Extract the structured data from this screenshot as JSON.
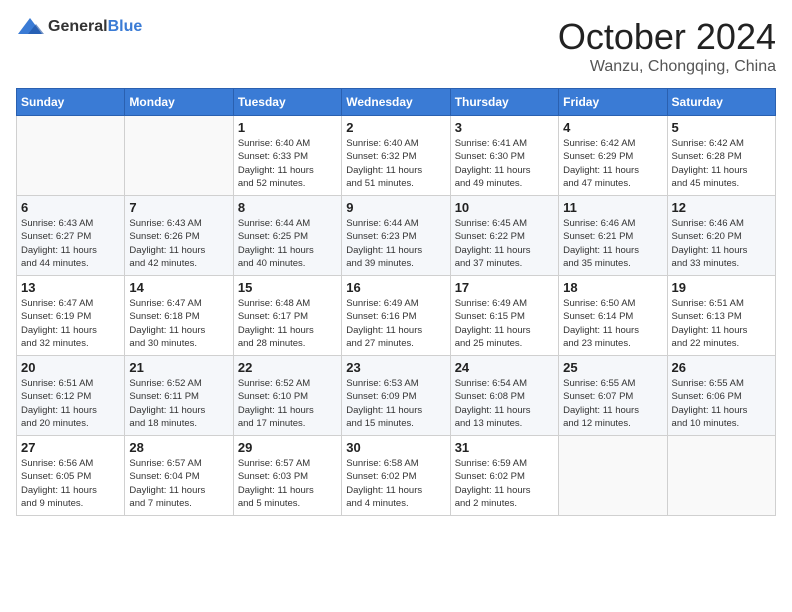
{
  "logo": {
    "general": "General",
    "blue": "Blue"
  },
  "title": {
    "month": "October 2024",
    "location": "Wanzu, Chongqing, China"
  },
  "headers": [
    "Sunday",
    "Monday",
    "Tuesday",
    "Wednesday",
    "Thursday",
    "Friday",
    "Saturday"
  ],
  "weeks": [
    [
      {
        "day": "",
        "info": ""
      },
      {
        "day": "",
        "info": ""
      },
      {
        "day": "1",
        "info": "Sunrise: 6:40 AM\nSunset: 6:33 PM\nDaylight: 11 hours\nand 52 minutes."
      },
      {
        "day": "2",
        "info": "Sunrise: 6:40 AM\nSunset: 6:32 PM\nDaylight: 11 hours\nand 51 minutes."
      },
      {
        "day": "3",
        "info": "Sunrise: 6:41 AM\nSunset: 6:30 PM\nDaylight: 11 hours\nand 49 minutes."
      },
      {
        "day": "4",
        "info": "Sunrise: 6:42 AM\nSunset: 6:29 PM\nDaylight: 11 hours\nand 47 minutes."
      },
      {
        "day": "5",
        "info": "Sunrise: 6:42 AM\nSunset: 6:28 PM\nDaylight: 11 hours\nand 45 minutes."
      }
    ],
    [
      {
        "day": "6",
        "info": "Sunrise: 6:43 AM\nSunset: 6:27 PM\nDaylight: 11 hours\nand 44 minutes."
      },
      {
        "day": "7",
        "info": "Sunrise: 6:43 AM\nSunset: 6:26 PM\nDaylight: 11 hours\nand 42 minutes."
      },
      {
        "day": "8",
        "info": "Sunrise: 6:44 AM\nSunset: 6:25 PM\nDaylight: 11 hours\nand 40 minutes."
      },
      {
        "day": "9",
        "info": "Sunrise: 6:44 AM\nSunset: 6:23 PM\nDaylight: 11 hours\nand 39 minutes."
      },
      {
        "day": "10",
        "info": "Sunrise: 6:45 AM\nSunset: 6:22 PM\nDaylight: 11 hours\nand 37 minutes."
      },
      {
        "day": "11",
        "info": "Sunrise: 6:46 AM\nSunset: 6:21 PM\nDaylight: 11 hours\nand 35 minutes."
      },
      {
        "day": "12",
        "info": "Sunrise: 6:46 AM\nSunset: 6:20 PM\nDaylight: 11 hours\nand 33 minutes."
      }
    ],
    [
      {
        "day": "13",
        "info": "Sunrise: 6:47 AM\nSunset: 6:19 PM\nDaylight: 11 hours\nand 32 minutes."
      },
      {
        "day": "14",
        "info": "Sunrise: 6:47 AM\nSunset: 6:18 PM\nDaylight: 11 hours\nand 30 minutes."
      },
      {
        "day": "15",
        "info": "Sunrise: 6:48 AM\nSunset: 6:17 PM\nDaylight: 11 hours\nand 28 minutes."
      },
      {
        "day": "16",
        "info": "Sunrise: 6:49 AM\nSunset: 6:16 PM\nDaylight: 11 hours\nand 27 minutes."
      },
      {
        "day": "17",
        "info": "Sunrise: 6:49 AM\nSunset: 6:15 PM\nDaylight: 11 hours\nand 25 minutes."
      },
      {
        "day": "18",
        "info": "Sunrise: 6:50 AM\nSunset: 6:14 PM\nDaylight: 11 hours\nand 23 minutes."
      },
      {
        "day": "19",
        "info": "Sunrise: 6:51 AM\nSunset: 6:13 PM\nDaylight: 11 hours\nand 22 minutes."
      }
    ],
    [
      {
        "day": "20",
        "info": "Sunrise: 6:51 AM\nSunset: 6:12 PM\nDaylight: 11 hours\nand 20 minutes."
      },
      {
        "day": "21",
        "info": "Sunrise: 6:52 AM\nSunset: 6:11 PM\nDaylight: 11 hours\nand 18 minutes."
      },
      {
        "day": "22",
        "info": "Sunrise: 6:52 AM\nSunset: 6:10 PM\nDaylight: 11 hours\nand 17 minutes."
      },
      {
        "day": "23",
        "info": "Sunrise: 6:53 AM\nSunset: 6:09 PM\nDaylight: 11 hours\nand 15 minutes."
      },
      {
        "day": "24",
        "info": "Sunrise: 6:54 AM\nSunset: 6:08 PM\nDaylight: 11 hours\nand 13 minutes."
      },
      {
        "day": "25",
        "info": "Sunrise: 6:55 AM\nSunset: 6:07 PM\nDaylight: 11 hours\nand 12 minutes."
      },
      {
        "day": "26",
        "info": "Sunrise: 6:55 AM\nSunset: 6:06 PM\nDaylight: 11 hours\nand 10 minutes."
      }
    ],
    [
      {
        "day": "27",
        "info": "Sunrise: 6:56 AM\nSunset: 6:05 PM\nDaylight: 11 hours\nand 9 minutes."
      },
      {
        "day": "28",
        "info": "Sunrise: 6:57 AM\nSunset: 6:04 PM\nDaylight: 11 hours\nand 7 minutes."
      },
      {
        "day": "29",
        "info": "Sunrise: 6:57 AM\nSunset: 6:03 PM\nDaylight: 11 hours\nand 5 minutes."
      },
      {
        "day": "30",
        "info": "Sunrise: 6:58 AM\nSunset: 6:02 PM\nDaylight: 11 hours\nand 4 minutes."
      },
      {
        "day": "31",
        "info": "Sunrise: 6:59 AM\nSunset: 6:02 PM\nDaylight: 11 hours\nand 2 minutes."
      },
      {
        "day": "",
        "info": ""
      },
      {
        "day": "",
        "info": ""
      }
    ]
  ]
}
